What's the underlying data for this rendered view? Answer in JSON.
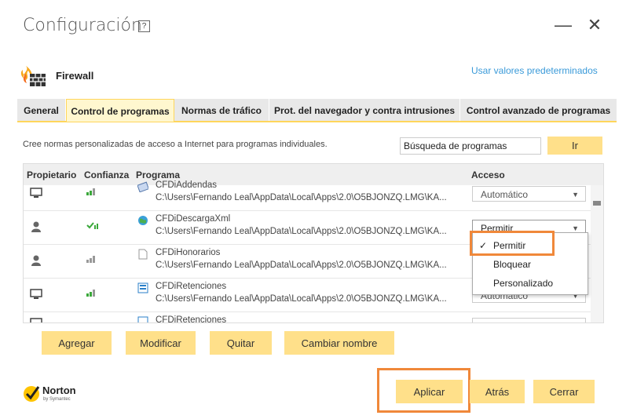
{
  "window": {
    "title": "Configuración",
    "help_label": "?",
    "minimize_label": "—",
    "close_label": "✕"
  },
  "header": {
    "section_label": "Firewall",
    "defaults_link": "Usar valores predeterminados"
  },
  "tabs": [
    {
      "label": "General",
      "active": false
    },
    {
      "label": "Control de programas",
      "active": true
    },
    {
      "label": "Normas de tráfico",
      "active": false
    },
    {
      "label": "Prot. del navegador y contra intrusiones",
      "active": false
    },
    {
      "label": "Control avanzado de programas",
      "active": false
    }
  ],
  "search": {
    "description": "Cree normas personalizadas de acceso a Internet para programas individuales.",
    "value": "Búsqueda de programas",
    "go_label": "Ir"
  },
  "table": {
    "columns": [
      "Propietario",
      "Confianza",
      "Programa",
      "Acceso"
    ],
    "rows": [
      {
        "owner_icon": "computer-icon",
        "trust_icon": "signal-bars-icon",
        "name": "CFDiAddendas",
        "path": "C:\\Users\\Fernando Leal\\AppData\\Local\\Apps\\2.0\\O5BJONZQ.LMG\\KA...",
        "access": "Automático"
      },
      {
        "owner_icon": "user-icon",
        "trust_icon": "check-trust-icon",
        "name": "CFDiDescargaXml",
        "path": "C:\\Users\\Fernando Leal\\AppData\\Local\\Apps\\2.0\\O5BJONZQ.LMG\\KA...",
        "access": "Permitir"
      },
      {
        "owner_icon": "user-icon",
        "trust_icon": "signal-bars-icon",
        "name": "CFDiHonorarios",
        "path": "C:\\Users\\Fernando Leal\\AppData\\Local\\Apps\\2.0\\O5BJONZQ.LMG\\KA...",
        "access": ""
      },
      {
        "owner_icon": "computer-icon",
        "trust_icon": "signal-bars-icon",
        "name": "CFDiRetenciones",
        "path": "C:\\Users\\Fernando Leal\\AppData\\Local\\Apps\\2.0\\O5BJONZQ.LMG\\KA...",
        "access": "Automático"
      },
      {
        "owner_icon": "computer-icon",
        "trust_icon": "signal-bars-icon",
        "name": "CFDiRetenciones",
        "path": "",
        "access": ""
      }
    ]
  },
  "dropdown": {
    "options": [
      "Permitir",
      "Bloquear",
      "Personalizado"
    ],
    "selected": "Permitir",
    "check": "✓"
  },
  "actions": {
    "add": "Agregar",
    "modify": "Modificar",
    "remove": "Quitar",
    "rename": "Cambiar nombre"
  },
  "footer": {
    "brand": "Norton",
    "brand_sub": "by Symantec",
    "apply": "Aplicar",
    "back": "Atrás",
    "close": "Cerrar"
  },
  "colors": {
    "accent_yellow": "#ffe08a",
    "tab_border": "#ffd65b",
    "highlight_orange": "#f0883a",
    "link_blue": "#3a9ad9",
    "trust_green": "#3aa83a"
  }
}
